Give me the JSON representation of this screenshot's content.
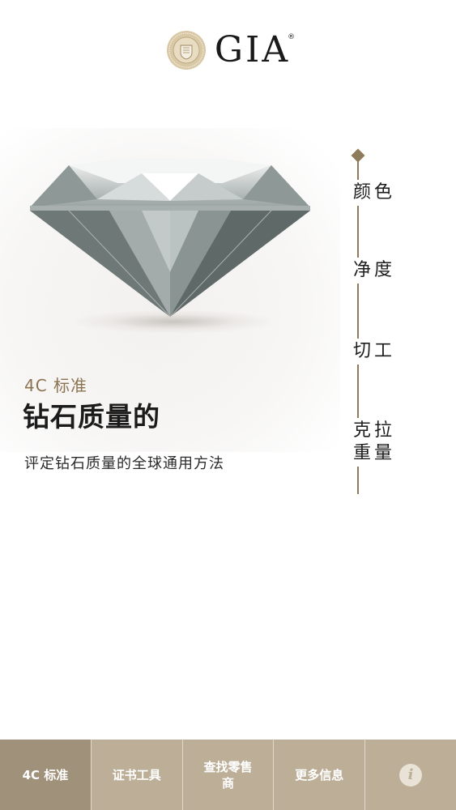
{
  "header": {
    "logo_text": "GIA",
    "logo_registered": "®"
  },
  "hero": {
    "label": "4C 标准",
    "title": "钻石质量的",
    "subtitle": "评定钻石质量的全球通用方法"
  },
  "rail": {
    "items": [
      {
        "label": "颜色"
      },
      {
        "label": "净度"
      },
      {
        "label": "切工"
      },
      {
        "label_line1": "克拉",
        "label_line2": "重量"
      }
    ]
  },
  "bottom_nav": {
    "tabs": [
      {
        "label": "4C 标准",
        "active": true
      },
      {
        "label": "证书工具"
      },
      {
        "label": "查找零售商"
      },
      {
        "label": "更多信息"
      }
    ],
    "info_icon": "info-icon",
    "info_glyph": "i"
  },
  "colors": {
    "gold_accent": "#8b7350",
    "rail": "#8d7b5c",
    "nav_bg": "#bcae97",
    "nav_active": "#a0917a"
  }
}
